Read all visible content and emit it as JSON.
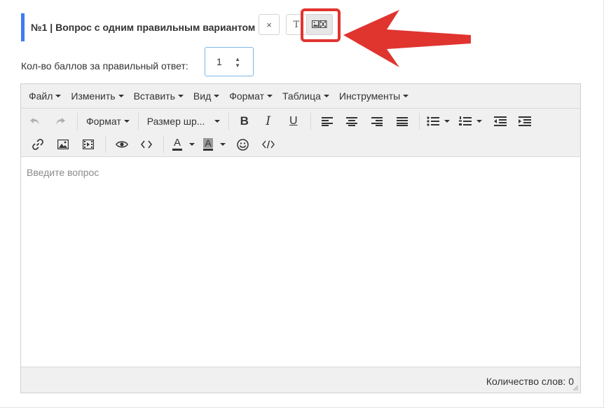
{
  "header": {
    "title": "№1 | Вопрос с одним правильным вариантом",
    "close_symbol": "×",
    "text_symbol": "T",
    "accent_color": "#3d7cf4",
    "highlight_color": "#e0342f"
  },
  "points": {
    "label": "Кол-во баллов за правильный ответ:",
    "value": "1"
  },
  "editor": {
    "menu": [
      "Файл",
      "Изменить",
      "Вставить",
      "Вид",
      "Формат",
      "Таблица",
      "Инструменты"
    ],
    "format_dropdown": "Формат",
    "size_dropdown": "Размер шр...",
    "placeholder": "Введите вопрос",
    "word_count": "Количество слов: 0"
  },
  "icons": [
    "undo-icon",
    "redo-icon",
    "bold-icon",
    "italic-icon",
    "underline-icon",
    "align-left-icon",
    "align-center-icon",
    "align-right-icon",
    "align-justify-icon",
    "bullet-list-icon",
    "numbered-list-icon",
    "outdent-icon",
    "indent-icon",
    "link-icon",
    "image-icon",
    "media-icon",
    "preview-icon",
    "code-icon",
    "text-color-icon",
    "background-color-icon",
    "emoticons-icon",
    "source-code-icon"
  ]
}
